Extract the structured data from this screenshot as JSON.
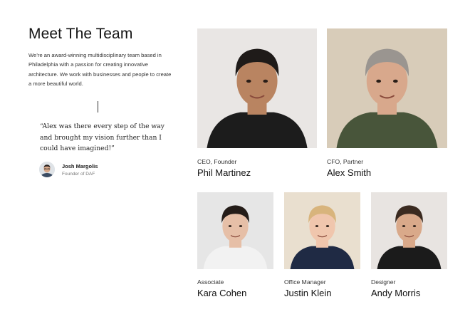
{
  "title": "Meet The Team",
  "intro": "We’re an award-winning multidisciplinary team based in Philadelphia with a passion for creating innovative architecture. We work with businesses and people to create a more beautiful world.",
  "testimonial": {
    "quote": "“Alex was there every step of the way and brought my vision further than I could have imagined!”",
    "author_name": "Josh Margolis",
    "author_role": "Founder of DAF"
  },
  "team": [
    {
      "role": "CEO, Founder",
      "name": "Phil Martinez",
      "bg": "#e9e6e4",
      "skin": "#b98461",
      "hair": "#1f1b19",
      "shirt": "#1c1c1c"
    },
    {
      "role": "CFO, Partner",
      "name": "Alex Smith",
      "bg": "#d8ccb9",
      "skin": "#d8a88c",
      "hair": "#9a9590",
      "shirt": "#48553a"
    },
    {
      "role": "Associate",
      "name": "Kara Cohen",
      "bg": "#e6e6e6",
      "skin": "#e6bfa7",
      "hair": "#241c18",
      "shirt": "#f2f2f2"
    },
    {
      "role": "Office Manager",
      "name": "Justin Klein",
      "bg": "#e9dfcf",
      "skin": "#f0c6ad",
      "hair": "#d8b47c",
      "shirt": "#1f2a44"
    },
    {
      "role": "Designer",
      "name": "Andy Morris",
      "bg": "#e8e4e1",
      "skin": "#d9a98a",
      "hair": "#3a2a20",
      "shirt": "#1b1b1b"
    }
  ]
}
